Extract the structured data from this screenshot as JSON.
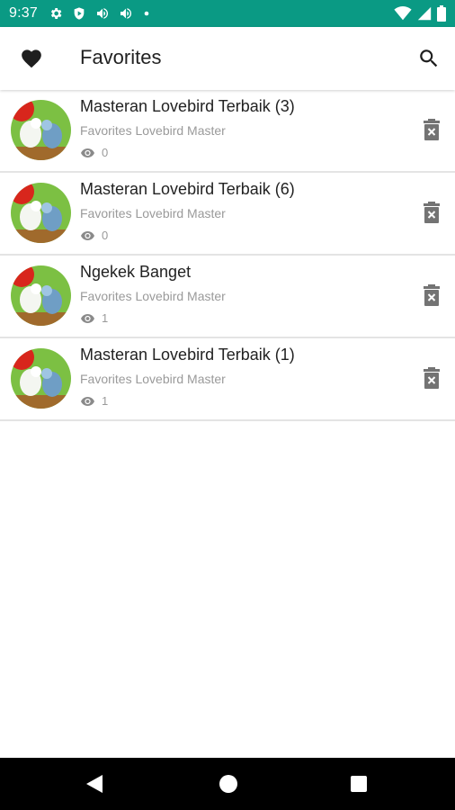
{
  "status_bar": {
    "time": "9:37",
    "left_icons": [
      "gear-icon",
      "shield-icon",
      "volume-icon",
      "volume-icon",
      "dot-icon"
    ],
    "right_icons": [
      "wifi-icon",
      "signal-icon",
      "battery-icon"
    ],
    "background_color": "#0a9a84"
  },
  "app_bar": {
    "title": "Favorites",
    "left_icon": "heart-icon",
    "right_icon": "search-icon"
  },
  "favorites": [
    {
      "title": "Masteran Lovebird Terbaik (3)",
      "subtitle": "Favorites Lovebird Master",
      "views": "0"
    },
    {
      "title": "Masteran Lovebird Terbaik (6)",
      "subtitle": "Favorites Lovebird Master",
      "views": "0"
    },
    {
      "title": "Ngekek Banget",
      "subtitle": "Favorites Lovebird Master",
      "views": "1"
    },
    {
      "title": "Masteran Lovebird Terbaik (1)",
      "subtitle": "Favorites Lovebird Master",
      "views": "1"
    }
  ],
  "item_icons": {
    "views": "eye-icon",
    "delete": "trash-icon"
  },
  "nav_bar": {
    "buttons": [
      "back-icon",
      "home-icon",
      "recents-icon"
    ]
  }
}
